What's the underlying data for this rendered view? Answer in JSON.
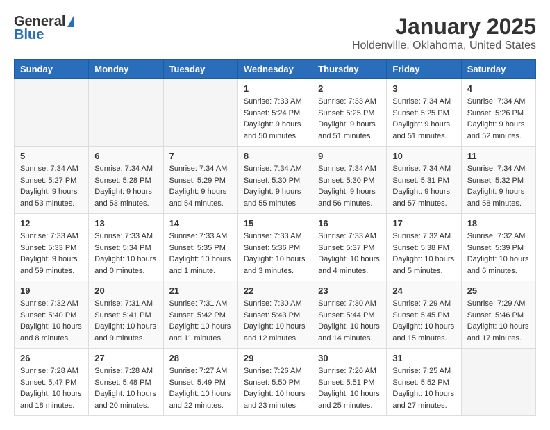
{
  "header": {
    "logo_general": "General",
    "logo_blue": "Blue",
    "month_title": "January 2025",
    "location": "Holdenville, Oklahoma, United States"
  },
  "weekdays": [
    "Sunday",
    "Monday",
    "Tuesday",
    "Wednesday",
    "Thursday",
    "Friday",
    "Saturday"
  ],
  "weeks": [
    [
      {
        "day": "",
        "info": ""
      },
      {
        "day": "",
        "info": ""
      },
      {
        "day": "",
        "info": ""
      },
      {
        "day": "1",
        "info": "Sunrise: 7:33 AM\nSunset: 5:24 PM\nDaylight: 9 hours\nand 50 minutes."
      },
      {
        "day": "2",
        "info": "Sunrise: 7:33 AM\nSunset: 5:25 PM\nDaylight: 9 hours\nand 51 minutes."
      },
      {
        "day": "3",
        "info": "Sunrise: 7:34 AM\nSunset: 5:25 PM\nDaylight: 9 hours\nand 51 minutes."
      },
      {
        "day": "4",
        "info": "Sunrise: 7:34 AM\nSunset: 5:26 PM\nDaylight: 9 hours\nand 52 minutes."
      }
    ],
    [
      {
        "day": "5",
        "info": "Sunrise: 7:34 AM\nSunset: 5:27 PM\nDaylight: 9 hours\nand 53 minutes."
      },
      {
        "day": "6",
        "info": "Sunrise: 7:34 AM\nSunset: 5:28 PM\nDaylight: 9 hours\nand 53 minutes."
      },
      {
        "day": "7",
        "info": "Sunrise: 7:34 AM\nSunset: 5:29 PM\nDaylight: 9 hours\nand 54 minutes."
      },
      {
        "day": "8",
        "info": "Sunrise: 7:34 AM\nSunset: 5:30 PM\nDaylight: 9 hours\nand 55 minutes."
      },
      {
        "day": "9",
        "info": "Sunrise: 7:34 AM\nSunset: 5:30 PM\nDaylight: 9 hours\nand 56 minutes."
      },
      {
        "day": "10",
        "info": "Sunrise: 7:34 AM\nSunset: 5:31 PM\nDaylight: 9 hours\nand 57 minutes."
      },
      {
        "day": "11",
        "info": "Sunrise: 7:34 AM\nSunset: 5:32 PM\nDaylight: 9 hours\nand 58 minutes."
      }
    ],
    [
      {
        "day": "12",
        "info": "Sunrise: 7:33 AM\nSunset: 5:33 PM\nDaylight: 9 hours\nand 59 minutes."
      },
      {
        "day": "13",
        "info": "Sunrise: 7:33 AM\nSunset: 5:34 PM\nDaylight: 10 hours\nand 0 minutes."
      },
      {
        "day": "14",
        "info": "Sunrise: 7:33 AM\nSunset: 5:35 PM\nDaylight: 10 hours\nand 1 minute."
      },
      {
        "day": "15",
        "info": "Sunrise: 7:33 AM\nSunset: 5:36 PM\nDaylight: 10 hours\nand 3 minutes."
      },
      {
        "day": "16",
        "info": "Sunrise: 7:33 AM\nSunset: 5:37 PM\nDaylight: 10 hours\nand 4 minutes."
      },
      {
        "day": "17",
        "info": "Sunrise: 7:32 AM\nSunset: 5:38 PM\nDaylight: 10 hours\nand 5 minutes."
      },
      {
        "day": "18",
        "info": "Sunrise: 7:32 AM\nSunset: 5:39 PM\nDaylight: 10 hours\nand 6 minutes."
      }
    ],
    [
      {
        "day": "19",
        "info": "Sunrise: 7:32 AM\nSunset: 5:40 PM\nDaylight: 10 hours\nand 8 minutes."
      },
      {
        "day": "20",
        "info": "Sunrise: 7:31 AM\nSunset: 5:41 PM\nDaylight: 10 hours\nand 9 minutes."
      },
      {
        "day": "21",
        "info": "Sunrise: 7:31 AM\nSunset: 5:42 PM\nDaylight: 10 hours\nand 11 minutes."
      },
      {
        "day": "22",
        "info": "Sunrise: 7:30 AM\nSunset: 5:43 PM\nDaylight: 10 hours\nand 12 minutes."
      },
      {
        "day": "23",
        "info": "Sunrise: 7:30 AM\nSunset: 5:44 PM\nDaylight: 10 hours\nand 14 minutes."
      },
      {
        "day": "24",
        "info": "Sunrise: 7:29 AM\nSunset: 5:45 PM\nDaylight: 10 hours\nand 15 minutes."
      },
      {
        "day": "25",
        "info": "Sunrise: 7:29 AM\nSunset: 5:46 PM\nDaylight: 10 hours\nand 17 minutes."
      }
    ],
    [
      {
        "day": "26",
        "info": "Sunrise: 7:28 AM\nSunset: 5:47 PM\nDaylight: 10 hours\nand 18 minutes."
      },
      {
        "day": "27",
        "info": "Sunrise: 7:28 AM\nSunset: 5:48 PM\nDaylight: 10 hours\nand 20 minutes."
      },
      {
        "day": "28",
        "info": "Sunrise: 7:27 AM\nSunset: 5:49 PM\nDaylight: 10 hours\nand 22 minutes."
      },
      {
        "day": "29",
        "info": "Sunrise: 7:26 AM\nSunset: 5:50 PM\nDaylight: 10 hours\nand 23 minutes."
      },
      {
        "day": "30",
        "info": "Sunrise: 7:26 AM\nSunset: 5:51 PM\nDaylight: 10 hours\nand 25 minutes."
      },
      {
        "day": "31",
        "info": "Sunrise: 7:25 AM\nSunset: 5:52 PM\nDaylight: 10 hours\nand 27 minutes."
      },
      {
        "day": "",
        "info": ""
      }
    ]
  ]
}
